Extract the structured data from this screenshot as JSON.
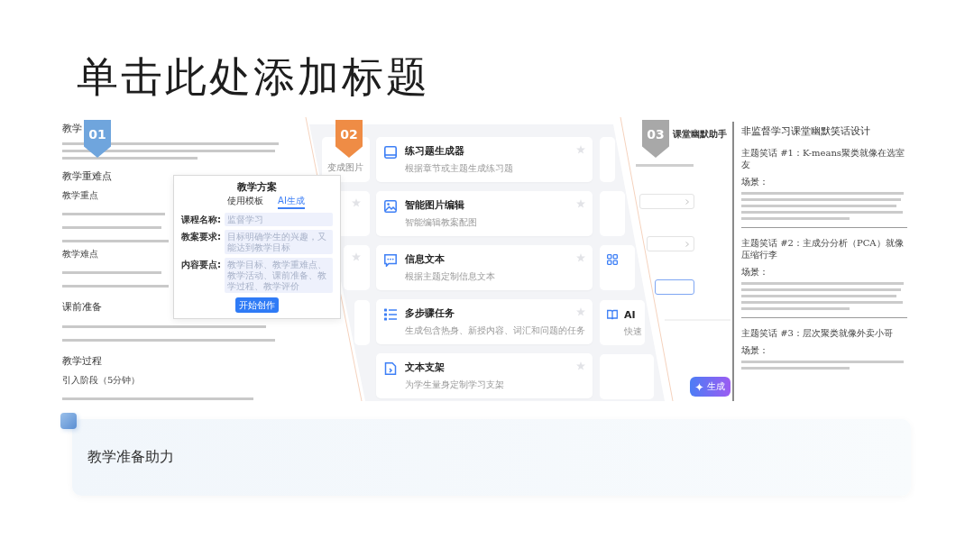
{
  "title": "单击此处添加标题",
  "badges": [
    {
      "label": "01",
      "color": "#6fa5dd"
    },
    {
      "label": "02",
      "color": "#ef8c45"
    },
    {
      "label": "03",
      "color": "#a8a8a8"
    }
  ],
  "lesson_doc": {
    "blocks": [
      {
        "kind": "heading",
        "text": "教学"
      },
      {
        "kind": "paragraph"
      },
      {
        "kind": "heading",
        "text": "教学重难点"
      },
      {
        "kind": "subheading",
        "text": "教学重点"
      },
      {
        "kind": "line"
      },
      {
        "kind": "line"
      },
      {
        "kind": "line"
      },
      {
        "kind": "subheading",
        "text": "教学难点"
      },
      {
        "kind": "line"
      },
      {
        "kind": "line"
      },
      {
        "kind": "heading",
        "text": "课前准备"
      },
      {
        "kind": "line"
      },
      {
        "kind": "line"
      },
      {
        "kind": "heading",
        "text": "教学过程"
      },
      {
        "kind": "subheading",
        "text": "引入阶段（5分钟）"
      },
      {
        "kind": "line"
      }
    ]
  },
  "dialog": {
    "title": "教学方案",
    "tabs": [
      {
        "label": "使用模板",
        "selected": false
      },
      {
        "label": "AI生成",
        "selected": true
      }
    ],
    "fields": [
      {
        "label": "课程名称:",
        "placeholder": "监督学习"
      },
      {
        "label": "教案要求:",
        "placeholder": "目标明确学生的兴趣，又能达到教学目标"
      },
      {
        "label": "内容要点:",
        "placeholder": "教学目标、教学重难点、教学活动、课前准备、教学过程、教学评价"
      }
    ],
    "button": "开始创作"
  },
  "side_card": {
    "description": "变成图片"
  },
  "tool_cards": [
    {
      "title": "练习题生成器",
      "description": "根据章节或主题生成练习题"
    },
    {
      "title": "智能图片编辑",
      "description": "智能编辑教案配图"
    },
    {
      "title": "信息文本",
      "description": "根据主题定制信息文本"
    },
    {
      "title": "多步骤任务",
      "description": "生成包含热身、新授内容、词汇和问题的任务"
    },
    {
      "title": "文本支架",
      "description": "为学生量身定制学习支架"
    }
  ],
  "partial_card": {
    "title": "AI",
    "description": "快速"
  },
  "humor_form": {
    "title": "课堂幽默助手",
    "fields": [
      {
        "kind": "select",
        "focused": false
      },
      {
        "kind": "select",
        "focused": false
      },
      {
        "kind": "input",
        "focused": true
      }
    ],
    "button": "生成"
  },
  "joke_doc": {
    "title": "非监督学习课堂幽默笑话设计",
    "sections": [
      {
        "heading": "主题笑话 #1：K-means聚类就像在选室友",
        "label": "场景："
      },
      {
        "heading": "主题笑话 #2：主成分分析（PCA）就像压缩行李",
        "label": "场景："
      },
      {
        "heading": "主题笑话 #3：层次聚类就像外卖小哥",
        "label": "场景："
      }
    ]
  },
  "summary_card": {
    "text": "教学准备助力"
  }
}
